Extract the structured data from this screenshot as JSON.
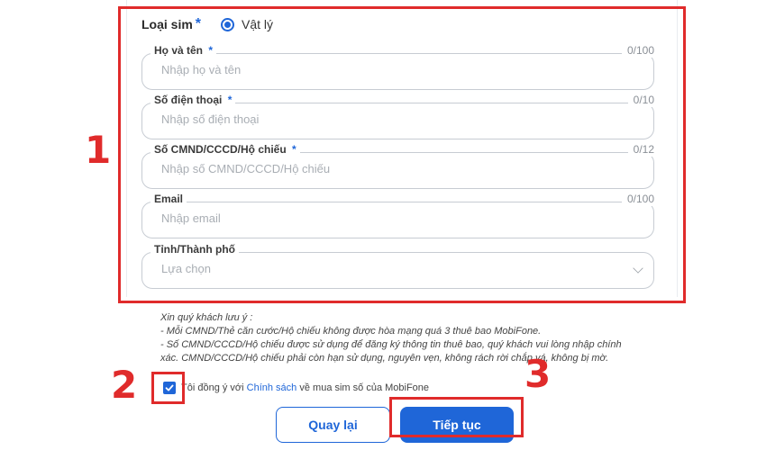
{
  "form": {
    "sim_type": {
      "label": "Loại sim",
      "required": "*",
      "option": "Vật lý"
    },
    "fields": [
      {
        "label": "Họ và tên",
        "required": "*",
        "counter": "0/100",
        "placeholder": "Nhập họ và tên"
      },
      {
        "label": "Số điện thoại",
        "required": "*",
        "counter": "0/10",
        "placeholder": "Nhập số điện thoại"
      },
      {
        "label": "Số CMND/CCCD/Hộ chiếu",
        "required": "*",
        "counter": "0/12",
        "placeholder": "Nhập số CMND/CCCD/Hộ chiếu"
      },
      {
        "label": "Email",
        "required": "",
        "counter": "0/100",
        "placeholder": "Nhập email"
      },
      {
        "label": "Tỉnh/Thành phố",
        "required": "",
        "counter": "",
        "placeholder": "Lựa chọn"
      }
    ]
  },
  "notes": {
    "title": "Xin quý khách lưu ý :",
    "line1": "- Mỗi CMND/Thẻ căn cước/Hộ chiếu không được hòa mạng quá 3 thuê bao MobiFone.",
    "line2": "- Số CMND/CCCD/Hộ chiếu được sử dụng để đăng ký thông tin thuê bao, quý khách vui lòng nhập chính",
    "line3": "xác. CMND/CCCD/Hộ chiếu phải còn hạn sử dụng, nguyên vẹn, không rách rời chắp vá, không bị mờ."
  },
  "agree": {
    "prefix": "Tôi đồng ý với",
    "link": "Chính sách",
    "suffix": "về mua sim số của MobiFone"
  },
  "buttons": {
    "back": "Quay lại",
    "next": "Tiếp tục"
  },
  "callouts": {
    "one": "1",
    "two": "2",
    "three": "3"
  },
  "colors": {
    "accent": "#1f66d8",
    "annotation": "#e02b2b"
  }
}
